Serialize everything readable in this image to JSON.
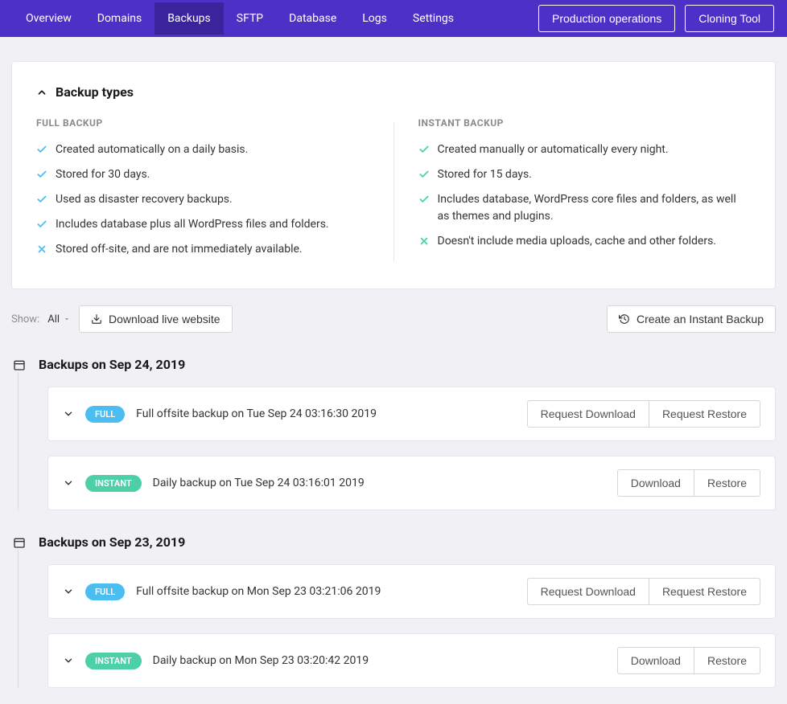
{
  "nav": {
    "tabs": [
      "Overview",
      "Domains",
      "Backups",
      "SFTP",
      "Database",
      "Logs",
      "Settings"
    ],
    "active_index": 2,
    "actions": {
      "production_ops": "Production operations",
      "cloning_tool": "Cloning Tool"
    }
  },
  "card": {
    "title": "Backup types",
    "full": {
      "heading": "FULL BACKUP",
      "items": [
        {
          "ok": true,
          "text": "Created automatically on a daily basis."
        },
        {
          "ok": true,
          "text": "Stored for 30 days."
        },
        {
          "ok": true,
          "text": "Used as disaster recovery backups."
        },
        {
          "ok": true,
          "text": "Includes database plus all WordPress files and folders."
        },
        {
          "ok": false,
          "text": "Stored off-site, and are not immediately available."
        }
      ]
    },
    "instant": {
      "heading": "INSTANT BACKUP",
      "items": [
        {
          "ok": true,
          "text": "Created manually or automatically every night."
        },
        {
          "ok": true,
          "text": "Stored for 15 days."
        },
        {
          "ok": true,
          "text": "Includes database, WordPress core files and folders, as well as themes and plugins."
        },
        {
          "ok": false,
          "text": "Doesn't include media uploads, cache and other folders."
        }
      ]
    }
  },
  "toolbar": {
    "show_label": "Show:",
    "show_value": "All",
    "download_live": "Download live website",
    "create_instant": "Create an Instant Backup"
  },
  "groups": [
    {
      "title": "Backups on Sep 24, 2019",
      "rows": [
        {
          "type": "FULL",
          "desc": "Full offsite backup on Tue Sep 24 03:16:30 2019",
          "primary": "Request Download",
          "secondary": "Request Restore"
        },
        {
          "type": "INSTANT",
          "desc": "Daily backup on Tue Sep 24 03:16:01 2019",
          "primary": "Download",
          "secondary": "Restore"
        }
      ]
    },
    {
      "title": "Backups on Sep 23, 2019",
      "rows": [
        {
          "type": "FULL",
          "desc": "Full offsite backup on Mon Sep 23 03:21:06 2019",
          "primary": "Request Download",
          "secondary": "Request Restore"
        },
        {
          "type": "INSTANT",
          "desc": "Daily backup on Mon Sep 23 03:20:42 2019",
          "primary": "Download",
          "secondary": "Restore"
        }
      ]
    }
  ],
  "colors": {
    "check_blue": "#4cbdf1",
    "check_green": "#4dd0a6",
    "cross_blue": "#4cbdf1",
    "cross_green": "#4dd0a6"
  }
}
